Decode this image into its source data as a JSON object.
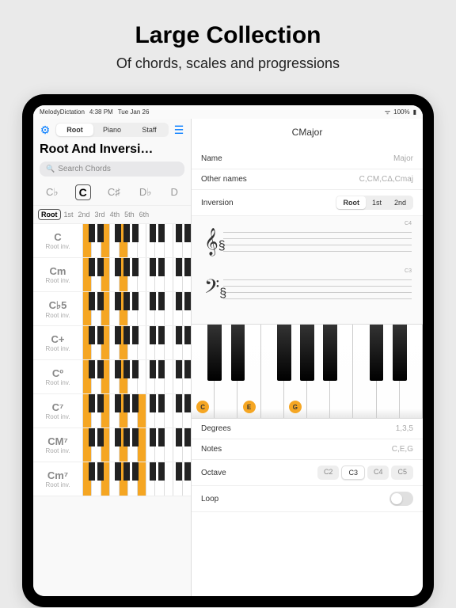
{
  "hero": {
    "title": "Large Collection",
    "subtitle": "Of chords, scales and progressions"
  },
  "statusbar": {
    "app": "MelodyDictation",
    "time": "4:38 PM",
    "date": "Tue Jan 26",
    "battery": "100%"
  },
  "tabs": {
    "root": "Root",
    "piano": "Piano",
    "staff": "Staff"
  },
  "sidebar": {
    "title": "Root And Inversi…",
    "search_placeholder": "Search Chords",
    "roots": [
      "C♭",
      "C",
      "C♯",
      "D♭",
      "D"
    ],
    "inversions": [
      "Root",
      "1st",
      "2nd",
      "3rd",
      "4th",
      "5th",
      "6th"
    ],
    "chords": [
      {
        "name": "C",
        "sub": "Root inv."
      },
      {
        "name": "Cm",
        "sub": "Root inv."
      },
      {
        "name": "C♭5",
        "sub": "Root inv."
      },
      {
        "name": "C+",
        "sub": "Root inv."
      },
      {
        "name": "Cº",
        "sub": "Root inv."
      },
      {
        "name": "C⁷",
        "sub": "Root inv."
      },
      {
        "name": "CM⁷",
        "sub": "Root inv."
      },
      {
        "name": "Cm⁷",
        "sub": "Root inv."
      }
    ]
  },
  "detail": {
    "title": "CMajor",
    "name_label": "Name",
    "name_val": "Major",
    "other_label": "Other names",
    "other_val": "C,CM,CΔ,Cmaj",
    "inv_label": "Inversion",
    "inv_opts": [
      "Root",
      "1st",
      "2nd"
    ],
    "staff_hi": "C4",
    "staff_lo": "C3",
    "notes_played": [
      "C",
      "E",
      "G"
    ],
    "degrees_label": "Degrees",
    "degrees_val": "1,3,5",
    "notes_label": "Notes",
    "notes_val": "C,E,G",
    "octave_label": "Octave",
    "octaves": [
      "C2",
      "C3",
      "C4",
      "C5"
    ],
    "loop_label": "Loop"
  }
}
